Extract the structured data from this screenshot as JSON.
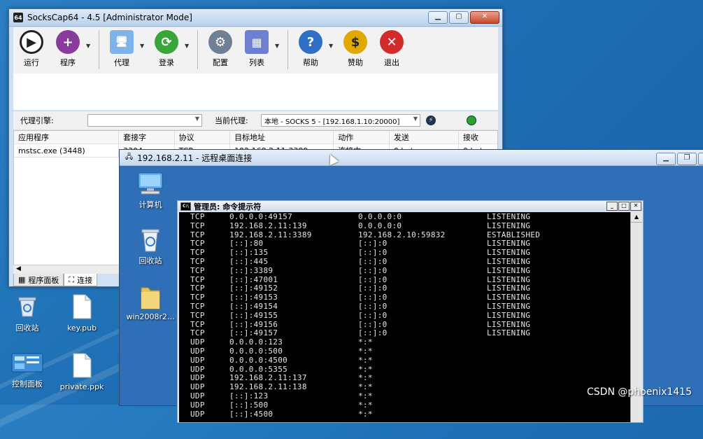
{
  "desktop": {
    "icons": [
      {
        "label": "回收站",
        "icon": "recycle-bin-icon"
      },
      {
        "label": "key.pub",
        "icon": "document-icon"
      },
      {
        "label": "控制面板",
        "icon": "control-panel-icon"
      },
      {
        "label": "private.ppk",
        "icon": "document-icon"
      }
    ],
    "watermark": "CSDN @phoenix1415"
  },
  "sockscap": {
    "title": "SocksCap64 - 4.5 [Administrator Mode]",
    "toolbar": [
      {
        "label": "运行",
        "icon": "play-icon",
        "color": "#2b2b2b"
      },
      {
        "label": "程序",
        "icon": "add-program-icon",
        "color": "#8a3c9c"
      },
      {
        "label": "代理",
        "icon": "proxy-computer-icon",
        "color": "#4a90d9"
      },
      {
        "label": "登录",
        "icon": "refresh-login-icon",
        "color": "#3aa63a"
      },
      {
        "label": "配置",
        "icon": "gear-icon",
        "color": "#6f7f94"
      },
      {
        "label": "列表",
        "icon": "grid-list-icon",
        "color": "#6c7fd0"
      },
      {
        "label": "帮助",
        "icon": "help-icon",
        "color": "#2f6fc6"
      },
      {
        "label": "赞助",
        "icon": "dollar-icon",
        "color": "#e0a800"
      },
      {
        "label": "退出",
        "icon": "exit-icon",
        "color": "#d12b2b"
      }
    ],
    "proxy_engine_label": "代理引擎:",
    "proxy_engine_value": "",
    "current_proxy_label": "当前代理:",
    "current_proxy_value": "本地 - SOCKS 5 - [192.168.1.10:20000]",
    "table": {
      "columns": [
        "应用程序",
        "套接字",
        "协议",
        "目标地址",
        "动作",
        "发送",
        "接收"
      ],
      "rows": [
        [
          "mstsc.exe (3448)",
          "3304",
          "TCP",
          "192.168.2.11:3389",
          "连接中",
          "0 bytes",
          "0 bytes"
        ]
      ]
    },
    "tabs": [
      "程序面板",
      "连接"
    ]
  },
  "rdp": {
    "title": "192.168.2.11 - 远程桌面连接",
    "icons": [
      {
        "label": "计算机",
        "icon": "computer-icon"
      },
      {
        "label": "回收站",
        "icon": "recycle-bin-icon"
      },
      {
        "label": "win2008r2...",
        "icon": "folder-icon"
      }
    ]
  },
  "cmd": {
    "title": "管理员: 命令提示符",
    "rows": [
      [
        "TCP",
        "0.0.0.0:49157",
        "0.0.0.0:0",
        "LISTENING"
      ],
      [
        "TCP",
        "192.168.2.11:139",
        "0.0.0.0:0",
        "LISTENING"
      ],
      [
        "TCP",
        "192.168.2.11:3389",
        "192.168.2.10:59832",
        "ESTABLISHED"
      ],
      [
        "TCP",
        "[::]:80",
        "[::]:0",
        "LISTENING"
      ],
      [
        "TCP",
        "[::]:135",
        "[::]:0",
        "LISTENING"
      ],
      [
        "TCP",
        "[::]:445",
        "[::]:0",
        "LISTENING"
      ],
      [
        "TCP",
        "[::]:3389",
        "[::]:0",
        "LISTENING"
      ],
      [
        "TCP",
        "[::]:47001",
        "[::]:0",
        "LISTENING"
      ],
      [
        "TCP",
        "[::]:49152",
        "[::]:0",
        "LISTENING"
      ],
      [
        "TCP",
        "[::]:49153",
        "[::]:0",
        "LISTENING"
      ],
      [
        "TCP",
        "[::]:49154",
        "[::]:0",
        "LISTENING"
      ],
      [
        "TCP",
        "[::]:49155",
        "[::]:0",
        "LISTENING"
      ],
      [
        "TCP",
        "[::]:49156",
        "[::]:0",
        "LISTENING"
      ],
      [
        "TCP",
        "[::]:49157",
        "[::]:0",
        "LISTENING"
      ],
      [
        "UDP",
        "0.0.0.0:123",
        "*:*",
        ""
      ],
      [
        "UDP",
        "0.0.0.0:500",
        "*:*",
        ""
      ],
      [
        "UDP",
        "0.0.0.0:4500",
        "*:*",
        ""
      ],
      [
        "UDP",
        "0.0.0.0:5355",
        "*:*",
        ""
      ],
      [
        "UDP",
        "192.168.2.11:137",
        "*:*",
        ""
      ],
      [
        "UDP",
        "192.168.2.11:138",
        "*:*",
        ""
      ],
      [
        "UDP",
        "[::]:123",
        "*:*",
        ""
      ],
      [
        "UDP",
        "[::]:500",
        "*:*",
        ""
      ],
      [
        "UDP",
        "[::]:4500",
        "*:*",
        ""
      ]
    ]
  }
}
